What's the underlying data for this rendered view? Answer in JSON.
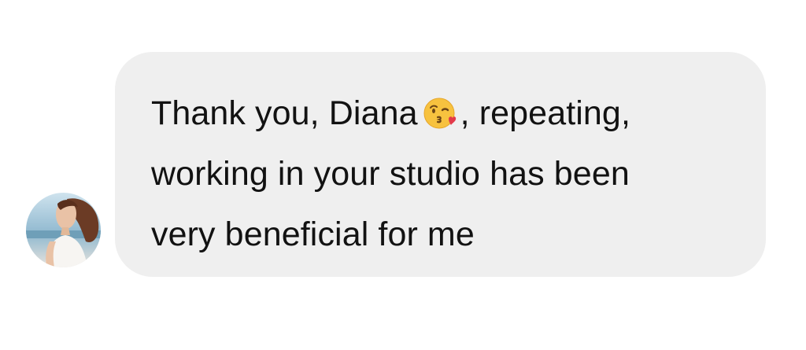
{
  "message": {
    "text_before_emoji": "Thank you, Diana",
    "emoji": "kissing-face-with-heart-icon",
    "text_after_emoji": ", repeating,\nworking in your studio has been\nvery beneficial for me"
  },
  "colors": {
    "bubble_background": "#efefef",
    "text": "#121212",
    "page_background": "#ffffff"
  }
}
